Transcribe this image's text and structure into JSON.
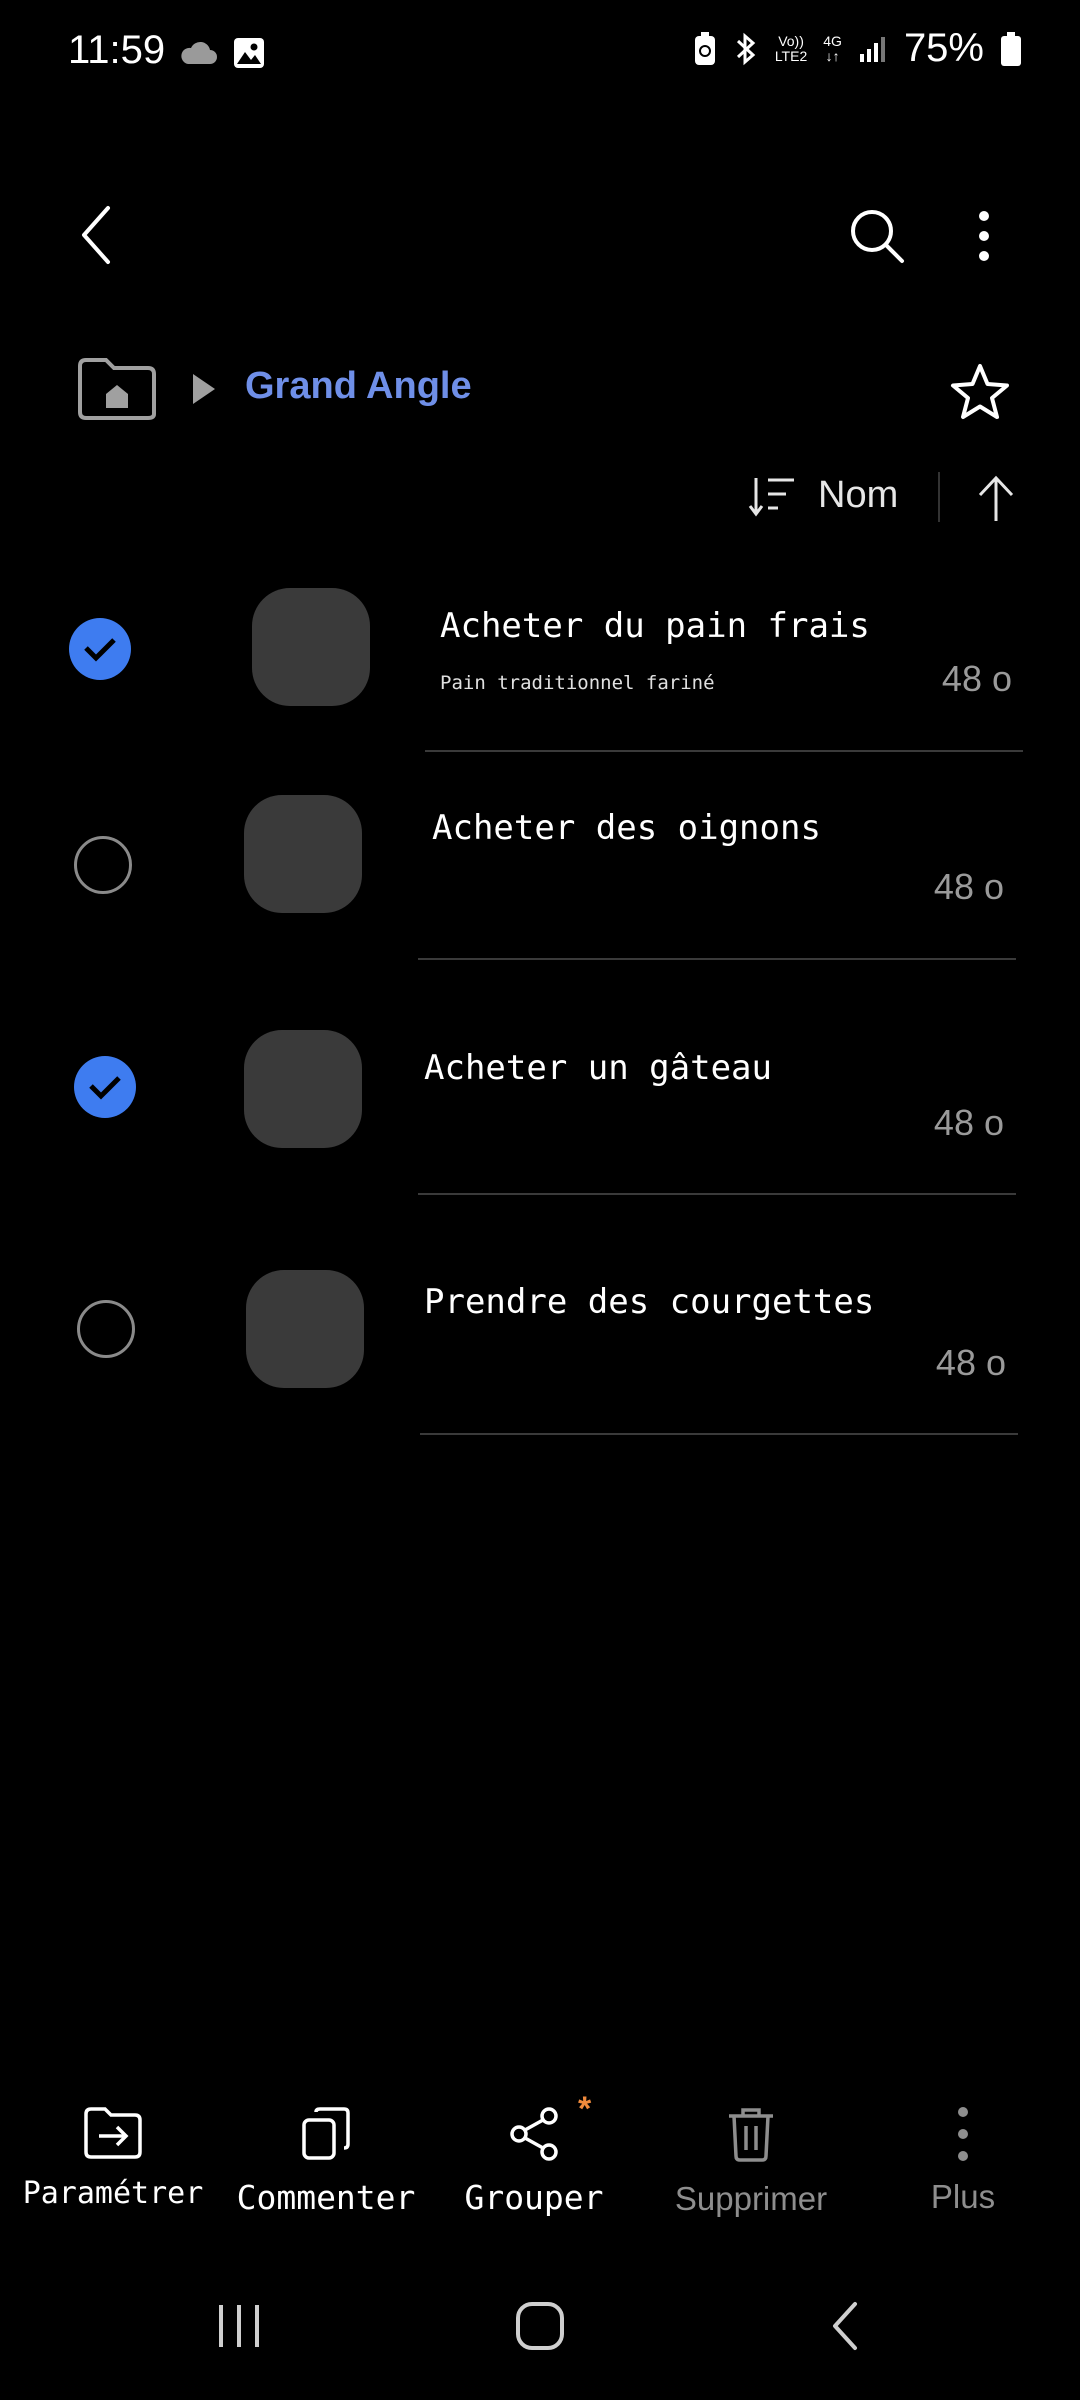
{
  "status_bar": {
    "time": "11:59",
    "battery": "75%",
    "volte": "Vo))",
    "lte": "LTE2",
    "network": "4G",
    "icons": [
      "cloud-icon",
      "image-icon",
      "battery-saver-icon",
      "bluetooth-icon",
      "signal-icon",
      "battery-icon"
    ]
  },
  "toolbar": {
    "icons": [
      "back-icon",
      "search-icon",
      "more-vertical-icon"
    ]
  },
  "breadcrumb": {
    "current": "Grand Angle",
    "icons": [
      "home-folder-icon",
      "play-arrow-icon",
      "star-outline-icon"
    ]
  },
  "sort": {
    "label": "Nom",
    "icons": [
      "sort-icon",
      "arrow-up-icon"
    ]
  },
  "items": [
    {
      "title": "Acheter du pain frais",
      "subtitle": "Pain traditionnel fariné",
      "size": "48 o",
      "checked": true
    },
    {
      "title": "Acheter des oignons",
      "subtitle": "",
      "size": "48 o",
      "checked": false
    },
    {
      "title": "Acheter un gâteau",
      "subtitle": "",
      "size": "48 o",
      "checked": true
    },
    {
      "title": "Prendre des courgettes",
      "subtitle": "",
      "size": "48 o",
      "checked": false
    }
  ],
  "actions": [
    {
      "label": "Paramétrer",
      "icon": "move-to-folder-icon"
    },
    {
      "label": "Commenter",
      "icon": "copy-icon"
    },
    {
      "label": "Grouper",
      "icon": "share-icon",
      "badge": "*"
    },
    {
      "label": "Supprimer",
      "icon": "trash-icon"
    },
    {
      "label": "Plus",
      "icon": "more-vertical-icon"
    }
  ],
  "nav_bar": {
    "icons": [
      "recents-icon",
      "home-icon",
      "back-nav-icon"
    ]
  },
  "colors": {
    "accent": "#3e7cf0",
    "breadcrumb": "#6f8fe8",
    "badge": "#f08a3c",
    "background": "#000000"
  }
}
